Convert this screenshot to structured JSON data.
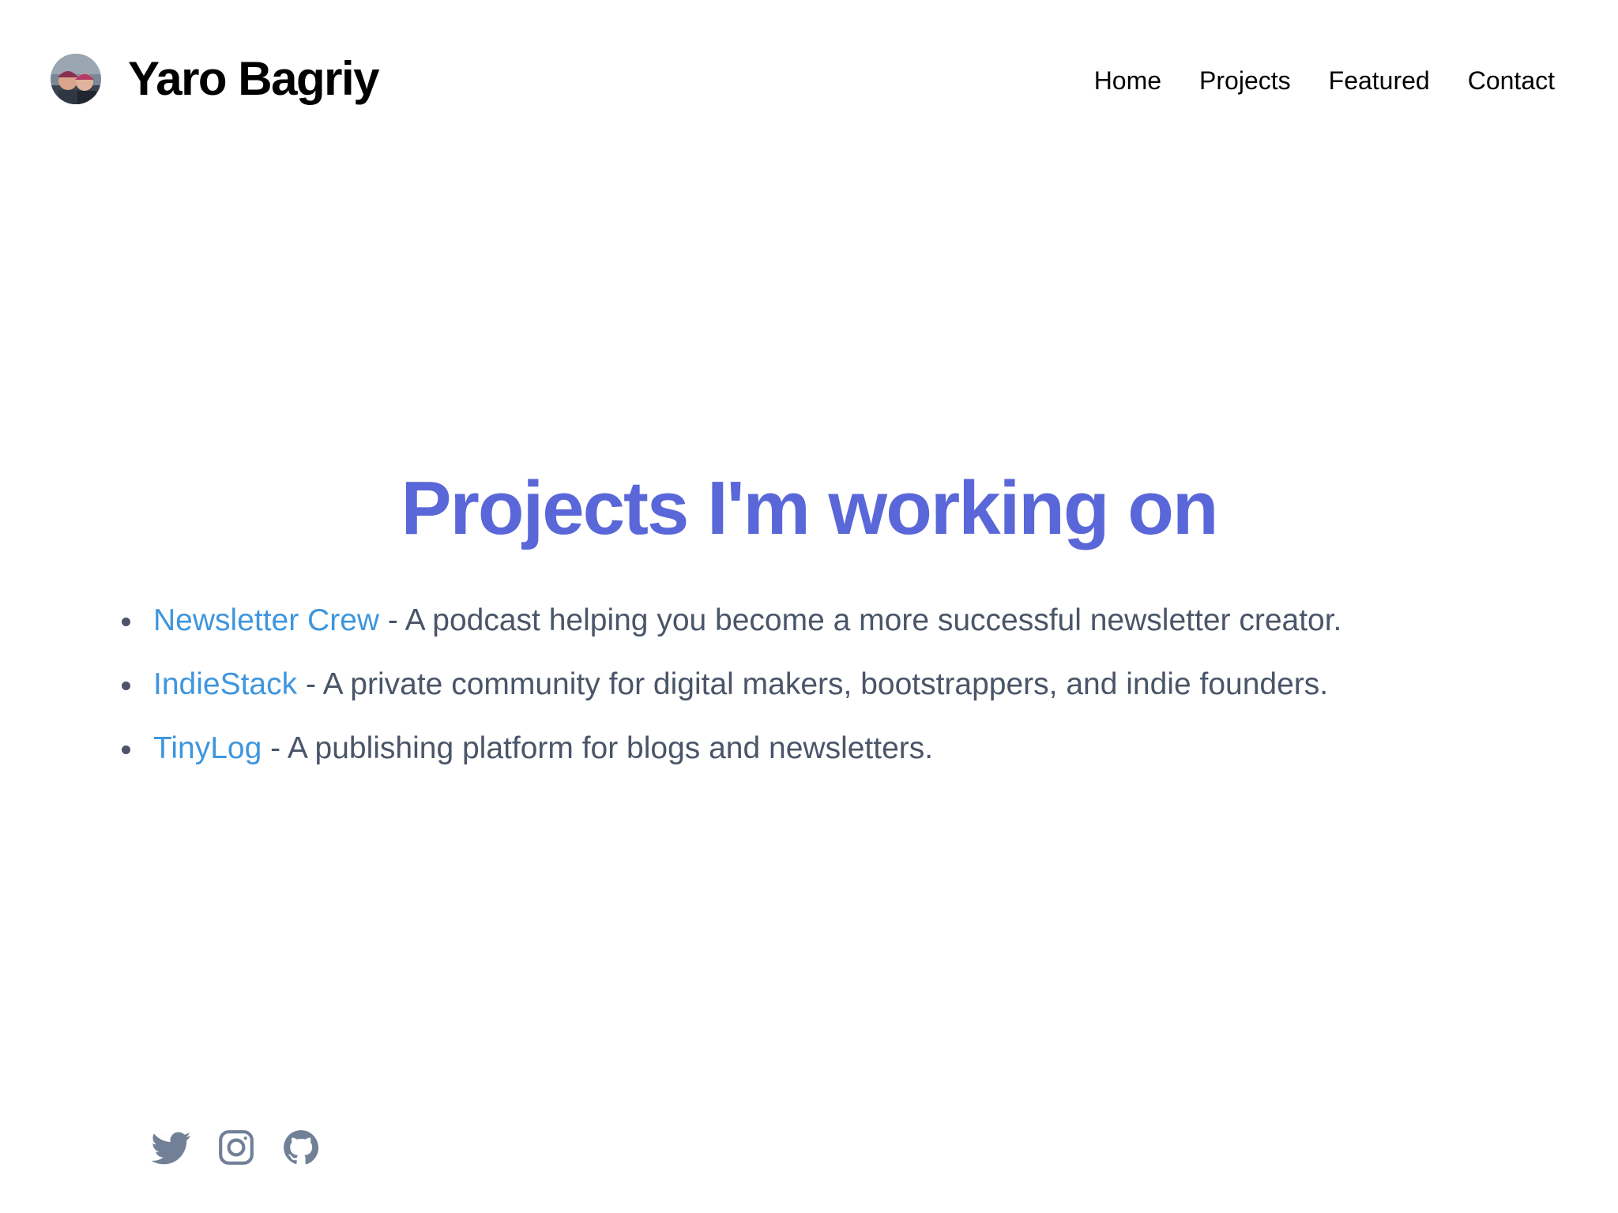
{
  "header": {
    "site_title": "Yaro Bagriy",
    "nav": [
      {
        "label": "Home"
      },
      {
        "label": "Projects"
      },
      {
        "label": "Featured"
      },
      {
        "label": "Contact"
      }
    ]
  },
  "main": {
    "title": "Projects I'm working on",
    "projects": [
      {
        "name": "Newsletter Crew",
        "description": " - A podcast helping you become a more successful newsletter creator."
      },
      {
        "name": "IndieStack",
        "description": " - A private community for digital makers, bootstrappers, and indie founders."
      },
      {
        "name": "TinyLog",
        "description": " - A publishing platform for blogs and newsletters."
      }
    ]
  },
  "footer": {
    "social_icons": [
      "twitter-icon",
      "instagram-icon",
      "github-icon"
    ]
  },
  "colors": {
    "title": "#5a67d8",
    "link": "#3f96dd",
    "body_text": "#4a5568",
    "icon": "#718096"
  }
}
